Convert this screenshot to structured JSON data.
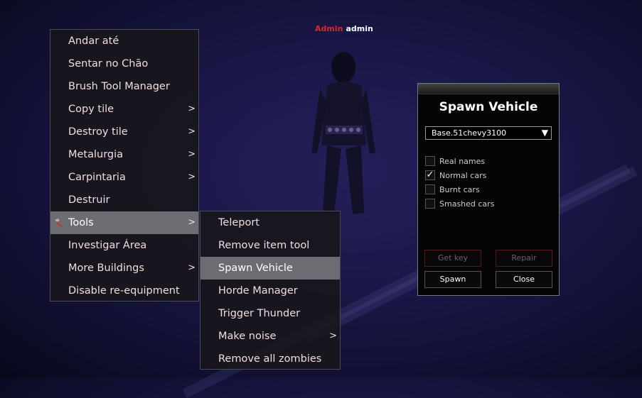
{
  "nameplate": {
    "tag": "Admin",
    "user": "admin"
  },
  "context_menu": {
    "items": [
      {
        "label": "Andar até",
        "arrow": ""
      },
      {
        "label": "Sentar no Chão",
        "arrow": ""
      },
      {
        "label": "Brush Tool Manager",
        "arrow": ""
      },
      {
        "label": "Copy tile",
        "arrow": ">"
      },
      {
        "label": "Destroy tile",
        "arrow": ">"
      },
      {
        "label": "Metalurgia",
        "arrow": ">"
      },
      {
        "label": "Carpintaria",
        "arrow": ">"
      },
      {
        "label": "Destruir",
        "arrow": ""
      },
      {
        "label": "Tools",
        "arrow": ">"
      },
      {
        "label": "Investigar Área",
        "arrow": ""
      },
      {
        "label": "More Buildings",
        "arrow": ">"
      },
      {
        "label": "Disable re-equipment",
        "arrow": ""
      }
    ],
    "highlighted": "Tools",
    "tools_icon": "hammer-icon"
  },
  "tools_submenu": {
    "items": [
      {
        "label": "Teleport",
        "arrow": ""
      },
      {
        "label": "Remove item tool",
        "arrow": ""
      },
      {
        "label": "Spawn Vehicle",
        "arrow": ""
      },
      {
        "label": "Horde Manager",
        "arrow": ""
      },
      {
        "label": "Trigger Thunder",
        "arrow": ""
      },
      {
        "label": "Make noise",
        "arrow": ">"
      },
      {
        "label": "Remove all zombies",
        "arrow": ""
      }
    ],
    "highlighted": "Spawn Vehicle"
  },
  "spawn_panel": {
    "title": "Spawn Vehicle",
    "selected_vehicle": "Base.51chevy3100",
    "dropdown_icon": "triangle-down-icon",
    "options": [
      {
        "label": "Real names",
        "checked": false,
        "mark": ""
      },
      {
        "label": "Normal cars",
        "checked": true,
        "mark": "✓"
      },
      {
        "label": "Burnt cars",
        "checked": false,
        "mark": ""
      },
      {
        "label": "Smashed cars",
        "checked": false,
        "mark": ""
      }
    ],
    "buttons": {
      "get_key": "Get key",
      "repair": "Repair",
      "spawn": "Spawn",
      "close": "Close"
    }
  },
  "colors": {
    "admin_tag": "#d42a2a",
    "menu_highlight": "#6c6c73",
    "disabled_border": "#5a1a1a"
  }
}
